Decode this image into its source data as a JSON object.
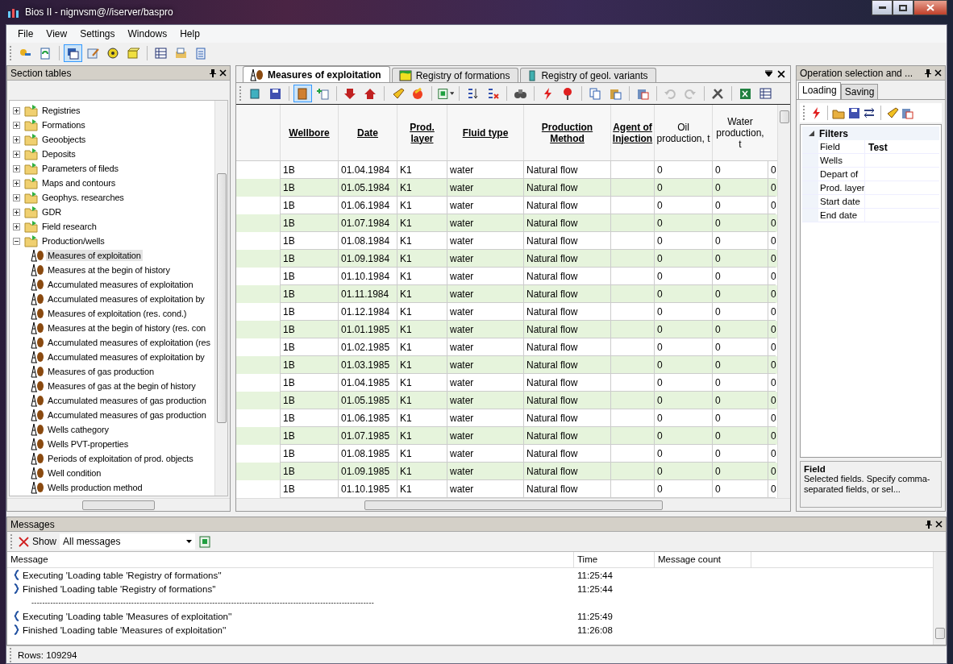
{
  "window": {
    "title": "Bios II - nignvsm@//iserver/baspro"
  },
  "menu": [
    "File",
    "View",
    "Settings",
    "Windows",
    "Help"
  ],
  "main_toolbar": [
    [
      {
        "pressed": false
      },
      {
        "pressed": false
      }
    ],
    [
      {
        "pressed": true
      },
      {
        "pressed": false
      },
      {
        "pressed": false
      },
      {
        "pressed": false
      }
    ],
    [
      {
        "pressed": false
      },
      {
        "pressed": false
      },
      {
        "pressed": false
      }
    ]
  ],
  "section_tables": {
    "title": "Section tables",
    "tree": [
      {
        "label": "Registries",
        "expanded": false,
        "selected": false
      },
      {
        "label": "Formations",
        "expanded": false,
        "selected": false
      },
      {
        "label": "Geoobjects",
        "expanded": false,
        "selected": false
      },
      {
        "label": "Deposits",
        "expanded": false,
        "selected": false
      },
      {
        "label": "Parameters of fileds",
        "expanded": false,
        "selected": false
      },
      {
        "label": "Maps and contours",
        "expanded": false,
        "selected": false
      },
      {
        "label": "Geophys. researches",
        "expanded": false,
        "selected": false
      },
      {
        "label": "GDR",
        "expanded": false,
        "selected": false
      },
      {
        "label": "Field research",
        "expanded": false,
        "selected": false
      },
      {
        "label": "Production/wells",
        "expanded": true,
        "selected": false,
        "children": [
          {
            "label": "Measures of exploitation",
            "selected": true
          },
          {
            "label": "Measures at the begin of history",
            "selected": false
          },
          {
            "label": "Accumulated measures of exploitation",
            "selected": false
          },
          {
            "label": "Accumulated measures of exploitation by",
            "selected": false
          },
          {
            "label": "Measures of exploitation (res. cond.)",
            "selected": false
          },
          {
            "label": "Measures at the begin of history (res. con",
            "selected": false
          },
          {
            "label": "Accumulated measures of exploitation (res",
            "selected": false
          },
          {
            "label": "Accumulated measures of exploitation by",
            "selected": false
          },
          {
            "label": "Measures of gas production",
            "selected": false
          },
          {
            "label": "Measures of gas at the begin of history",
            "selected": false
          },
          {
            "label": "Accumulated measures of gas production",
            "selected": false
          },
          {
            "label": "Accumulated measures of gas production",
            "selected": false
          },
          {
            "label": "Wells cathegory",
            "selected": false
          },
          {
            "label": "Wells PVT-properties",
            "selected": false
          },
          {
            "label": "Periods of exploitation of prod. objects",
            "selected": false
          },
          {
            "label": "Well condition",
            "selected": false
          },
          {
            "label": "Wells production method",
            "selected": false
          }
        ]
      }
    ]
  },
  "document_tabs": [
    {
      "label": "Measures of exploitation",
      "selected": true
    },
    {
      "label": "Registry of formations",
      "selected": false
    },
    {
      "label": "Registry of geol. variants",
      "selected": false
    }
  ],
  "grid_toolbar": [
    [
      {
        "pressed": false,
        "disabled": false
      },
      {
        "pressed": false,
        "disabled": false
      }
    ],
    [
      {
        "pressed": true,
        "disabled": false
      },
      {
        "pressed": false,
        "disabled": false
      }
    ],
    [
      {
        "pressed": false,
        "disabled": false
      },
      {
        "pressed": false,
        "disabled": false
      }
    ],
    [
      {
        "pressed": false,
        "disabled": false
      },
      {
        "pressed": false,
        "disabled": false
      }
    ],
    [
      {
        "pressed": false,
        "disabled": false
      }
    ],
    [
      {
        "pressed": false,
        "disabled": false
      },
      {
        "pressed": false,
        "disabled": false
      }
    ],
    [
      {
        "pressed": false,
        "disabled": false
      }
    ],
    [
      {
        "pressed": false,
        "disabled": false
      },
      {
        "pressed": false,
        "disabled": false
      }
    ],
    [
      {
        "pressed": false,
        "disabled": false
      },
      {
        "pressed": false,
        "disabled": false
      }
    ],
    [
      {
        "pressed": false,
        "disabled": false
      }
    ],
    [
      {
        "pressed": false,
        "disabled": true
      },
      {
        "pressed": false,
        "disabled": true
      }
    ],
    [
      {
        "pressed": false,
        "disabled": false
      }
    ],
    [
      {
        "pressed": false,
        "disabled": false
      },
      {
        "pressed": false,
        "disabled": false
      }
    ]
  ],
  "table": {
    "columns": [
      {
        "label": "Wellbore",
        "kind": "linked"
      },
      {
        "label": "Date",
        "kind": "linked"
      },
      {
        "label": "Prod. layer",
        "kind": "linked"
      },
      {
        "label": "Fluid type",
        "kind": "linked"
      },
      {
        "label": "Production Method",
        "kind": "linked"
      },
      {
        "label": "Agent of Injection",
        "kind": "linked"
      },
      {
        "label": "Oil production, t",
        "kind": "plain"
      },
      {
        "label": "Water production, t",
        "kind": "plain"
      }
    ],
    "rows": [
      [
        "1B",
        "01.04.1984",
        "K1",
        "water",
        "Natural flow",
        "",
        "0",
        "0",
        "0"
      ],
      [
        "1B",
        "01.05.1984",
        "K1",
        "water",
        "Natural flow",
        "",
        "0",
        "0",
        "0"
      ],
      [
        "1B",
        "01.06.1984",
        "K1",
        "water",
        "Natural flow",
        "",
        "0",
        "0",
        "0"
      ],
      [
        "1B",
        "01.07.1984",
        "K1",
        "water",
        "Natural flow",
        "",
        "0",
        "0",
        "0"
      ],
      [
        "1B",
        "01.08.1984",
        "K1",
        "water",
        "Natural flow",
        "",
        "0",
        "0",
        "0"
      ],
      [
        "1B",
        "01.09.1984",
        "K1",
        "water",
        "Natural flow",
        "",
        "0",
        "0",
        "0"
      ],
      [
        "1B",
        "01.10.1984",
        "K1",
        "water",
        "Natural flow",
        "",
        "0",
        "0",
        "0"
      ],
      [
        "1B",
        "01.11.1984",
        "K1",
        "water",
        "Natural flow",
        "",
        "0",
        "0",
        "0"
      ],
      [
        "1B",
        "01.12.1984",
        "K1",
        "water",
        "Natural flow",
        "",
        "0",
        "0",
        "0"
      ],
      [
        "1B",
        "01.01.1985",
        "K1",
        "water",
        "Natural flow",
        "",
        "0",
        "0",
        "0"
      ],
      [
        "1B",
        "01.02.1985",
        "K1",
        "water",
        "Natural flow",
        "",
        "0",
        "0",
        "0"
      ],
      [
        "1B",
        "01.03.1985",
        "K1",
        "water",
        "Natural flow",
        "",
        "0",
        "0",
        "0"
      ],
      [
        "1B",
        "01.04.1985",
        "K1",
        "water",
        "Natural flow",
        "",
        "0",
        "0",
        "0"
      ],
      [
        "1B",
        "01.05.1985",
        "K1",
        "water",
        "Natural flow",
        "",
        "0",
        "0",
        "0"
      ],
      [
        "1B",
        "01.06.1985",
        "K1",
        "water",
        "Natural flow",
        "",
        "0",
        "0",
        "0"
      ],
      [
        "1B",
        "01.07.1985",
        "K1",
        "water",
        "Natural flow",
        "",
        "0",
        "0",
        "0"
      ],
      [
        "1B",
        "01.08.1985",
        "K1",
        "water",
        "Natural flow",
        "",
        "0",
        "0",
        "0"
      ],
      [
        "1B",
        "01.09.1985",
        "K1",
        "water",
        "Natural flow",
        "",
        "0",
        "0",
        "0"
      ],
      [
        "1B",
        "01.10.1985",
        "K1",
        "water",
        "Natural flow",
        "",
        "0",
        "0",
        "0"
      ]
    ]
  },
  "operation_panel": {
    "title": "Operation selection and ...",
    "tabs": [
      {
        "label": "Loading",
        "selected": true
      },
      {
        "label": "Saving",
        "selected": false
      }
    ],
    "category": {
      "label": "Filters",
      "expanded": true
    },
    "properties": [
      {
        "name": "Field",
        "value": "Test"
      },
      {
        "name": "Wells"
      },
      {
        "name": "Depart of"
      },
      {
        "name": "Prod. layer"
      },
      {
        "name": "Start date"
      },
      {
        "name": "End date"
      }
    ],
    "help": {
      "title": "Field",
      "text": "Selected fields. Specify comma-separated fields, or sel..."
    }
  },
  "messages": {
    "title": "Messages",
    "show_label": "Show",
    "filter": "All messages",
    "columns": [
      "Message",
      "Time",
      "Message count"
    ],
    "rows": [
      {
        "kind": "start",
        "text": "Executing 'Loading table 'Registry of formations''",
        "time": "11:25:44"
      },
      {
        "kind": "end",
        "text": "Finished 'Loading table 'Registry of formations''",
        "time": "11:25:44"
      },
      {
        "kind": "separator",
        "text": "-------------------------------------------------------------------------------------------------------------------------------"
      },
      {
        "kind": "start",
        "text": "Executing 'Loading table 'Measures of exploitation''",
        "time": "11:25:49"
      },
      {
        "kind": "end",
        "text": "Finished 'Loading table 'Measures of exploitation''",
        "time": "11:26:08"
      }
    ]
  },
  "status_bar": "Rows: 109294"
}
